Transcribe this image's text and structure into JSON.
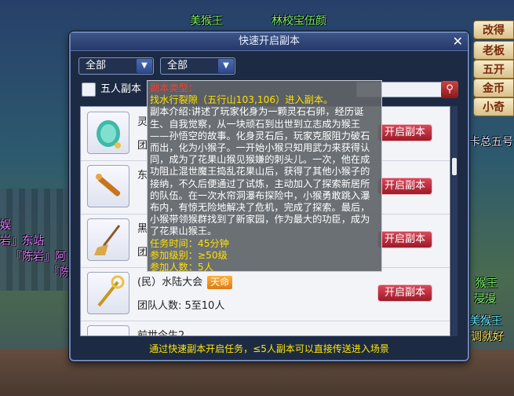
{
  "background": {
    "texts": [
      {
        "text": "美猴王",
        "x": 0
      },
      {
        "text": "林校宝伍颜",
        "x": 1
      },
      {
        "text": "娱",
        "x": 2
      },
      {
        "text": "岩』东站",
        "x": 3
      },
      {
        "text": "『陈岩』阿",
        "x": 4
      },
      {
        "text": "『陈",
        "x": 5
      },
      {
        "text": "猴王",
        "x": 6
      },
      {
        "text": "浸漫",
        "x": 7
      },
      {
        "text": "美猴王",
        "x": 8
      },
      {
        "text": "调就好",
        "x": 9
      },
      {
        "text": "卡总五号",
        "x": 10
      }
    ],
    "right_buttons": [
      "改得",
      "老板",
      "五开",
      "金币",
      "小奇"
    ]
  },
  "panel": {
    "title": "快速开启副本",
    "filter1": "全部",
    "filter2": "全部",
    "checkbox_label": "五人副本",
    "rows": [
      {
        "name": "灵",
        "tag": "",
        "count": "团"
      },
      {
        "name": "东",
        "tag": "",
        "count": ""
      },
      {
        "name": "黑",
        "tag": "",
        "count": "团"
      },
      {
        "name": "(民）水陆大会",
        "tag": "天命",
        "count": "团队人数: 5至10人"
      },
      {
        "name": "前世今生2",
        "tag": "",
        "count": ""
      }
    ],
    "open_label": "开启副本",
    "footer": "通过快速副本开启任务，≤5人副本可以直接传送进入场景"
  },
  "tooltip": {
    "type": "副本类型：",
    "title": "找水行裂隙（五行山103,106）进入副本。",
    "description": "副本介绍:讲述了玩家化身为一颗灵石石卵，经历诞生、自我觉察，从一块顽石到出世到立志成为猴王——孙悟空的故事。化身灵石后，玩家克服阻力破石而出，化为小猴子。一开始小猴只知用武力来获得认同，成为了花果山猴见猴嫌的刺头儿。一次，他在成功阻止混世魔王捣乱花果山后，获得了其他小猴子的接纳，不久后便通过了试炼，主动加入了探索新居所的队伍。在一次水帘洞瀑布探险中，小猴勇敢跳入瀑布内，有惊无险地解决了危机，完成了探索。最后，小猴带领猴群找到了新家园，作为最大的功臣，成为了花果山猴王。",
    "time": "任务时间：45分钟",
    "level": "参加级别：≥50级",
    "people": "参加人数：5人"
  },
  "colors": {
    "accent": "#d8485a",
    "tooltip_title": "#ffe000",
    "tooltip_type": "#ff3b2a"
  }
}
